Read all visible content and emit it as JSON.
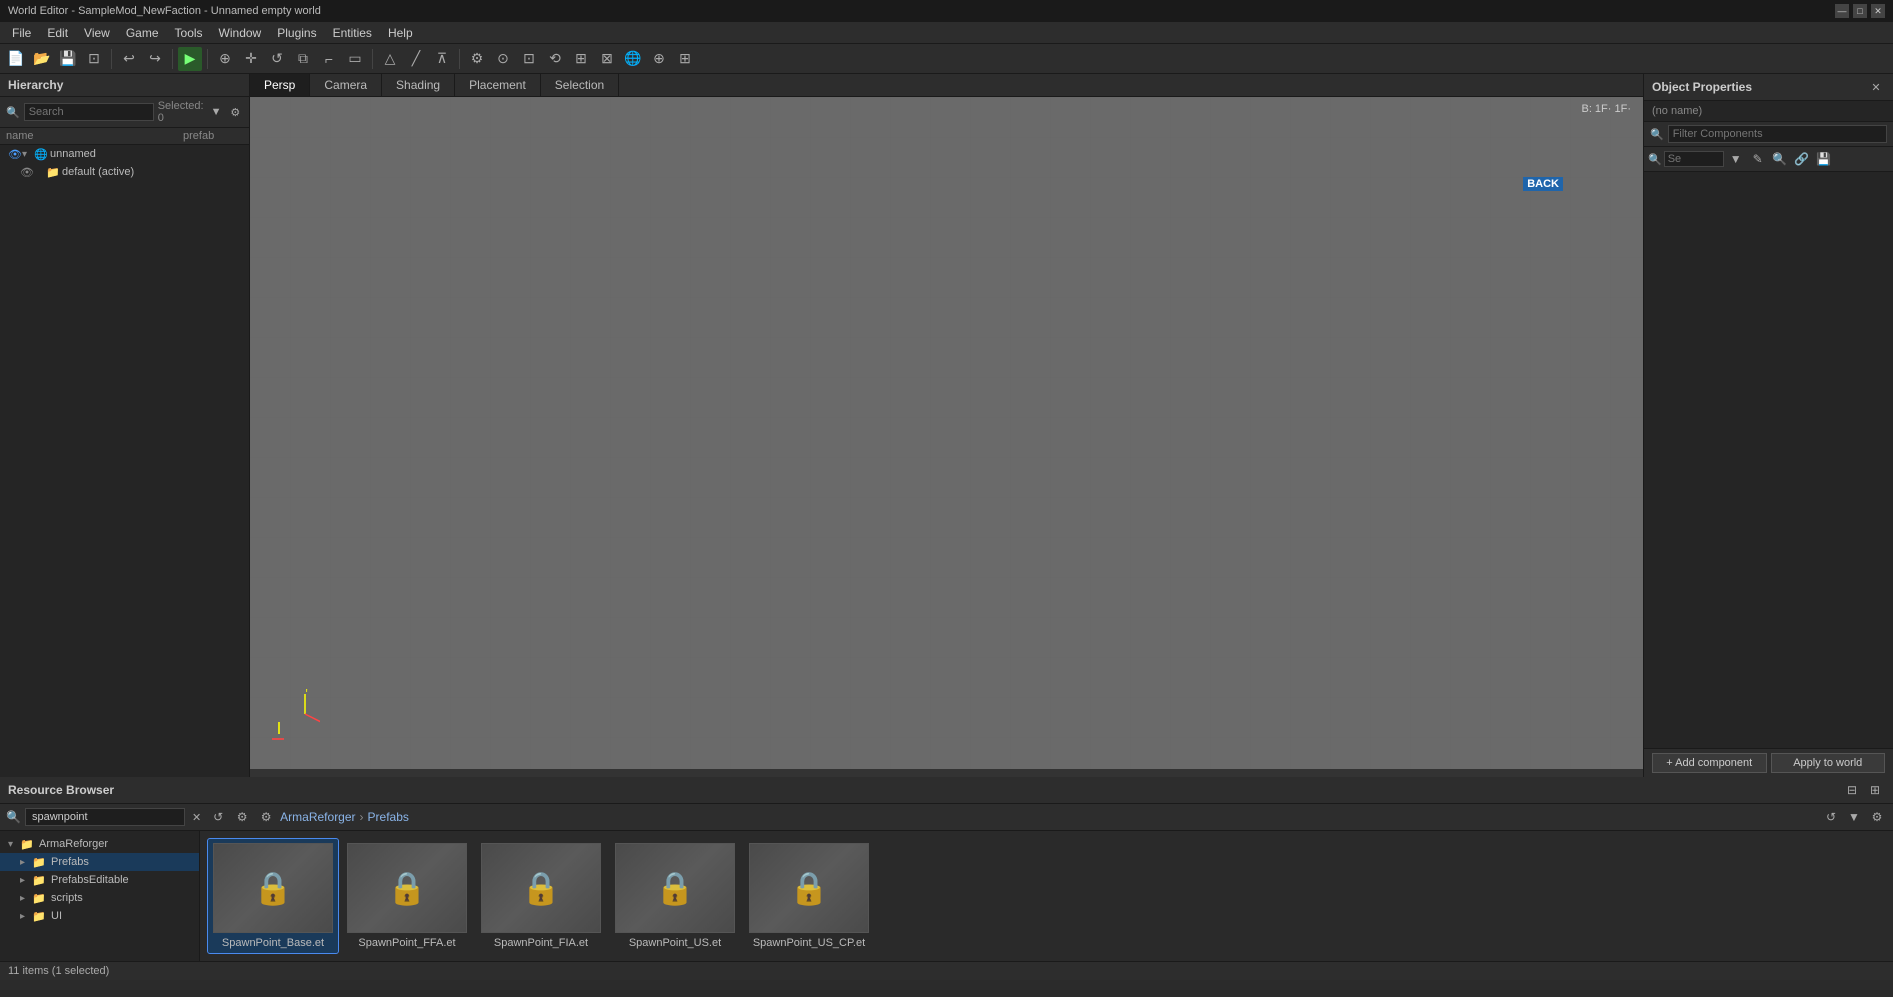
{
  "titleBar": {
    "title": "World Editor - SampleMod_NewFaction - Unnamed empty world",
    "controls": [
      "minimize",
      "maximize",
      "close"
    ]
  },
  "menuBar": {
    "items": [
      "File",
      "Edit",
      "View",
      "Game",
      "Tools",
      "Window",
      "Plugins",
      "Entities",
      "Help"
    ]
  },
  "toolbar": {
    "playBtn": "▶",
    "buttons": [
      "↩",
      "↪",
      "📄",
      "🔲",
      "⊕",
      "✛",
      "↺",
      "⧉",
      "⌐",
      "▭",
      "▷",
      "╱",
      "△",
      "⊼",
      "⊽",
      "⚙",
      "⊙",
      "⊡",
      "⟲",
      "⊞",
      "⊠",
      "⊕",
      "🌐",
      "⊡",
      "⊞"
    ]
  },
  "hierarchy": {
    "title": "Hierarchy",
    "search": {
      "placeholder": "Search",
      "value": ""
    },
    "selectedCount": "Selected: 0",
    "columns": {
      "name": "name",
      "prefab": "prefab"
    },
    "items": [
      {
        "id": "unnamed",
        "label": "unnamed",
        "level": 0,
        "hasChildren": true,
        "expanded": true,
        "iconColor": "#4a9eff"
      },
      {
        "id": "default",
        "label": "default (active)",
        "level": 1,
        "hasChildren": false,
        "expanded": false,
        "iconColor": "#888"
      }
    ]
  },
  "viewport": {
    "tabs": [
      "Persp",
      "Camera",
      "Shading",
      "Placement",
      "Selection"
    ],
    "activeTab": "Persp",
    "backLabel": "BACK",
    "coords": "B: 1F·  1F·"
  },
  "objectProperties": {
    "title": "Object Properties",
    "name": "(no name)",
    "filterPlaceholder": "Filter Components",
    "searchPlaceholder": "Se",
    "buttons": {
      "addComponent": "+ Add component",
      "applyToWorld": "Apply to world"
    }
  },
  "resourceBrowser": {
    "title": "Resource Browser",
    "searchValue": "spawnpoint",
    "searchPlaceholder": "spawnpoint",
    "breadcrumb": [
      "ArmaReforger",
      "Prefabs"
    ],
    "statusText": "11 items (1 selected)",
    "tree": [
      {
        "id": "armareforger",
        "label": "ArmaReforger",
        "level": 0,
        "expanded": true,
        "isFolder": true
      },
      {
        "id": "prefabs",
        "label": "Prefabs",
        "level": 1,
        "expanded": false,
        "isFolder": true,
        "selected": true
      },
      {
        "id": "prefabsEditable",
        "label": "PrefabsEditable",
        "level": 1,
        "expanded": false,
        "isFolder": true
      },
      {
        "id": "scripts",
        "label": "scripts",
        "level": 1,
        "expanded": false,
        "isFolder": true
      },
      {
        "id": "ui",
        "label": "UI",
        "level": 1,
        "expanded": false,
        "isFolder": true
      }
    ],
    "items": [
      {
        "id": "spawnpoint-base",
        "label": "SpawnPoint_Base.et",
        "selected": true
      },
      {
        "id": "spawnpoint-ffa",
        "label": "SpawnPoint_FFA.et",
        "selected": false
      },
      {
        "id": "spawnpoint-fia",
        "label": "SpawnPoint_FIA.et",
        "selected": false
      },
      {
        "id": "spawnpoint-us",
        "label": "SpawnPoint_US.et",
        "selected": false
      },
      {
        "id": "spawnpoint-us-cp",
        "label": "SpawnPoint_US_CP.et",
        "selected": false
      }
    ]
  },
  "icons": {
    "search": "🔍",
    "filter": "▼",
    "settings": "⚙",
    "eye": "👁",
    "folder": "📁",
    "folderOpen": "📂",
    "close": "✕",
    "refresh": "↺",
    "expand": "▸",
    "collapse": "▾",
    "lock": "🔒",
    "edit": "✎",
    "link": "🔗",
    "save": "💾",
    "add": "+",
    "chevronRight": "›",
    "minimize": "—",
    "maximize": "□",
    "closeWin": "✕",
    "globe": "🌐",
    "checkbox": "☐"
  }
}
